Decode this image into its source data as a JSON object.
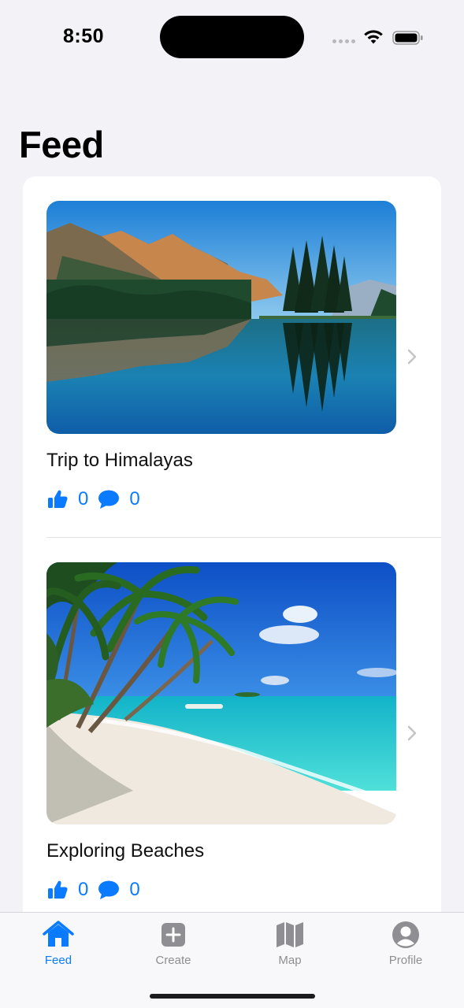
{
  "status_bar": {
    "time": "8:50"
  },
  "header": {
    "title": "Feed"
  },
  "posts": [
    {
      "title": "Trip to Himalayas",
      "likes": "0",
      "comments": "0",
      "image": "mountain-lake-photo"
    },
    {
      "title": "Exploring Beaches",
      "likes": "0",
      "comments": "0",
      "image": "tropical-beach-photo"
    }
  ],
  "tabs": [
    {
      "label": "Feed",
      "icon": "house-icon",
      "active": true
    },
    {
      "label": "Create",
      "icon": "plus-square-icon",
      "active": false
    },
    {
      "label": "Map",
      "icon": "map-icon",
      "active": false
    },
    {
      "label": "Profile",
      "icon": "person-circle-icon",
      "active": false
    }
  ],
  "colors": {
    "accent": "#0a7aff",
    "background": "#f2f2f7",
    "inactive": "#8e8e93"
  }
}
